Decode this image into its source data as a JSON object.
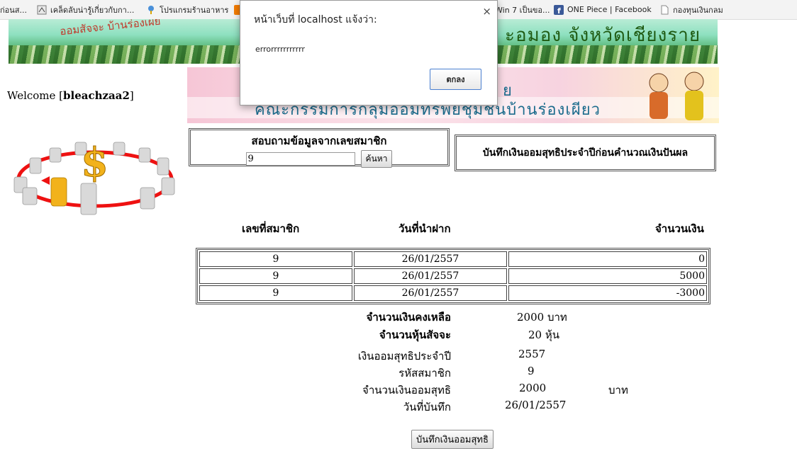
{
  "bookmarks": [
    {
      "label": "ก่อนส...",
      "icon": "page-icon"
    },
    {
      "label": "เคล็ดลับน่ารู้เกี่ยวกับกา...",
      "icon": "bookmark-site-icon"
    },
    {
      "label": "โปรแกรมร้านอาหาร",
      "icon": "bookmark-site-icon"
    },
    {
      "label": "Win 7 เป็นขอ...",
      "icon": "page-icon"
    },
    {
      "label": "ONE Piece | Facebook",
      "icon": "facebook-icon"
    },
    {
      "label": "กองทุนเงินกลม",
      "icon": "page-icon"
    }
  ],
  "banner": {
    "text_left": "ออมสัจจะ บ้านร่องเผย",
    "text_right": "ะอมอง จังหวัดเชียงราย"
  },
  "banner2": {
    "line1": "ย",
    "line2": "คณะกรรมการกลุ่มออมทรัพย์ชุมชนบ้านร่องเผียว"
  },
  "welcome": {
    "prefix": "Welcome",
    "username": "bleachzaa2"
  },
  "search": {
    "title": "สอบถามข้อมูลจากเลขสมาชิก",
    "value": "9",
    "button": "ค้นหา"
  },
  "save_header": "บันทึกเงินออมสุทธิประจำปีก่อนคำนวณเงินปันผล",
  "table": {
    "headers": [
      "เลขที่สมาชิก",
      "วันที่นำฝาก",
      "จำนวนเงิน"
    ],
    "rows": [
      [
        "9",
        "26/01/2557",
        "0"
      ],
      [
        "9",
        "26/01/2557",
        "5000"
      ],
      [
        "9",
        "26/01/2557",
        "-3000"
      ]
    ]
  },
  "summary": {
    "balance_label": "จำนวนเงินคงเหลือ",
    "balance_value": "2000 บาท",
    "shares_label": "จำนวนหุ้นสัจจะ",
    "shares_value": "20 หุ้น",
    "year_label": "เงินออมสุทธิประจำปี",
    "year_value": "2557",
    "member_label": "รหัสสมาชิก",
    "member_value": "9",
    "net_label": "จำนวนเงินออมสุทธิ",
    "net_value": "2000",
    "net_unit": "บาท",
    "date_label": "วันที่บันทึก",
    "date_value": "26/01/2557"
  },
  "save_button": "บันทึกเงินออมสุทธิ",
  "dialog": {
    "title": "หน้าเว็บที่ localhost แจ้งว่า:",
    "message": "errorrrrrrrrrrr",
    "ok": "ตกลง",
    "close": "×"
  }
}
